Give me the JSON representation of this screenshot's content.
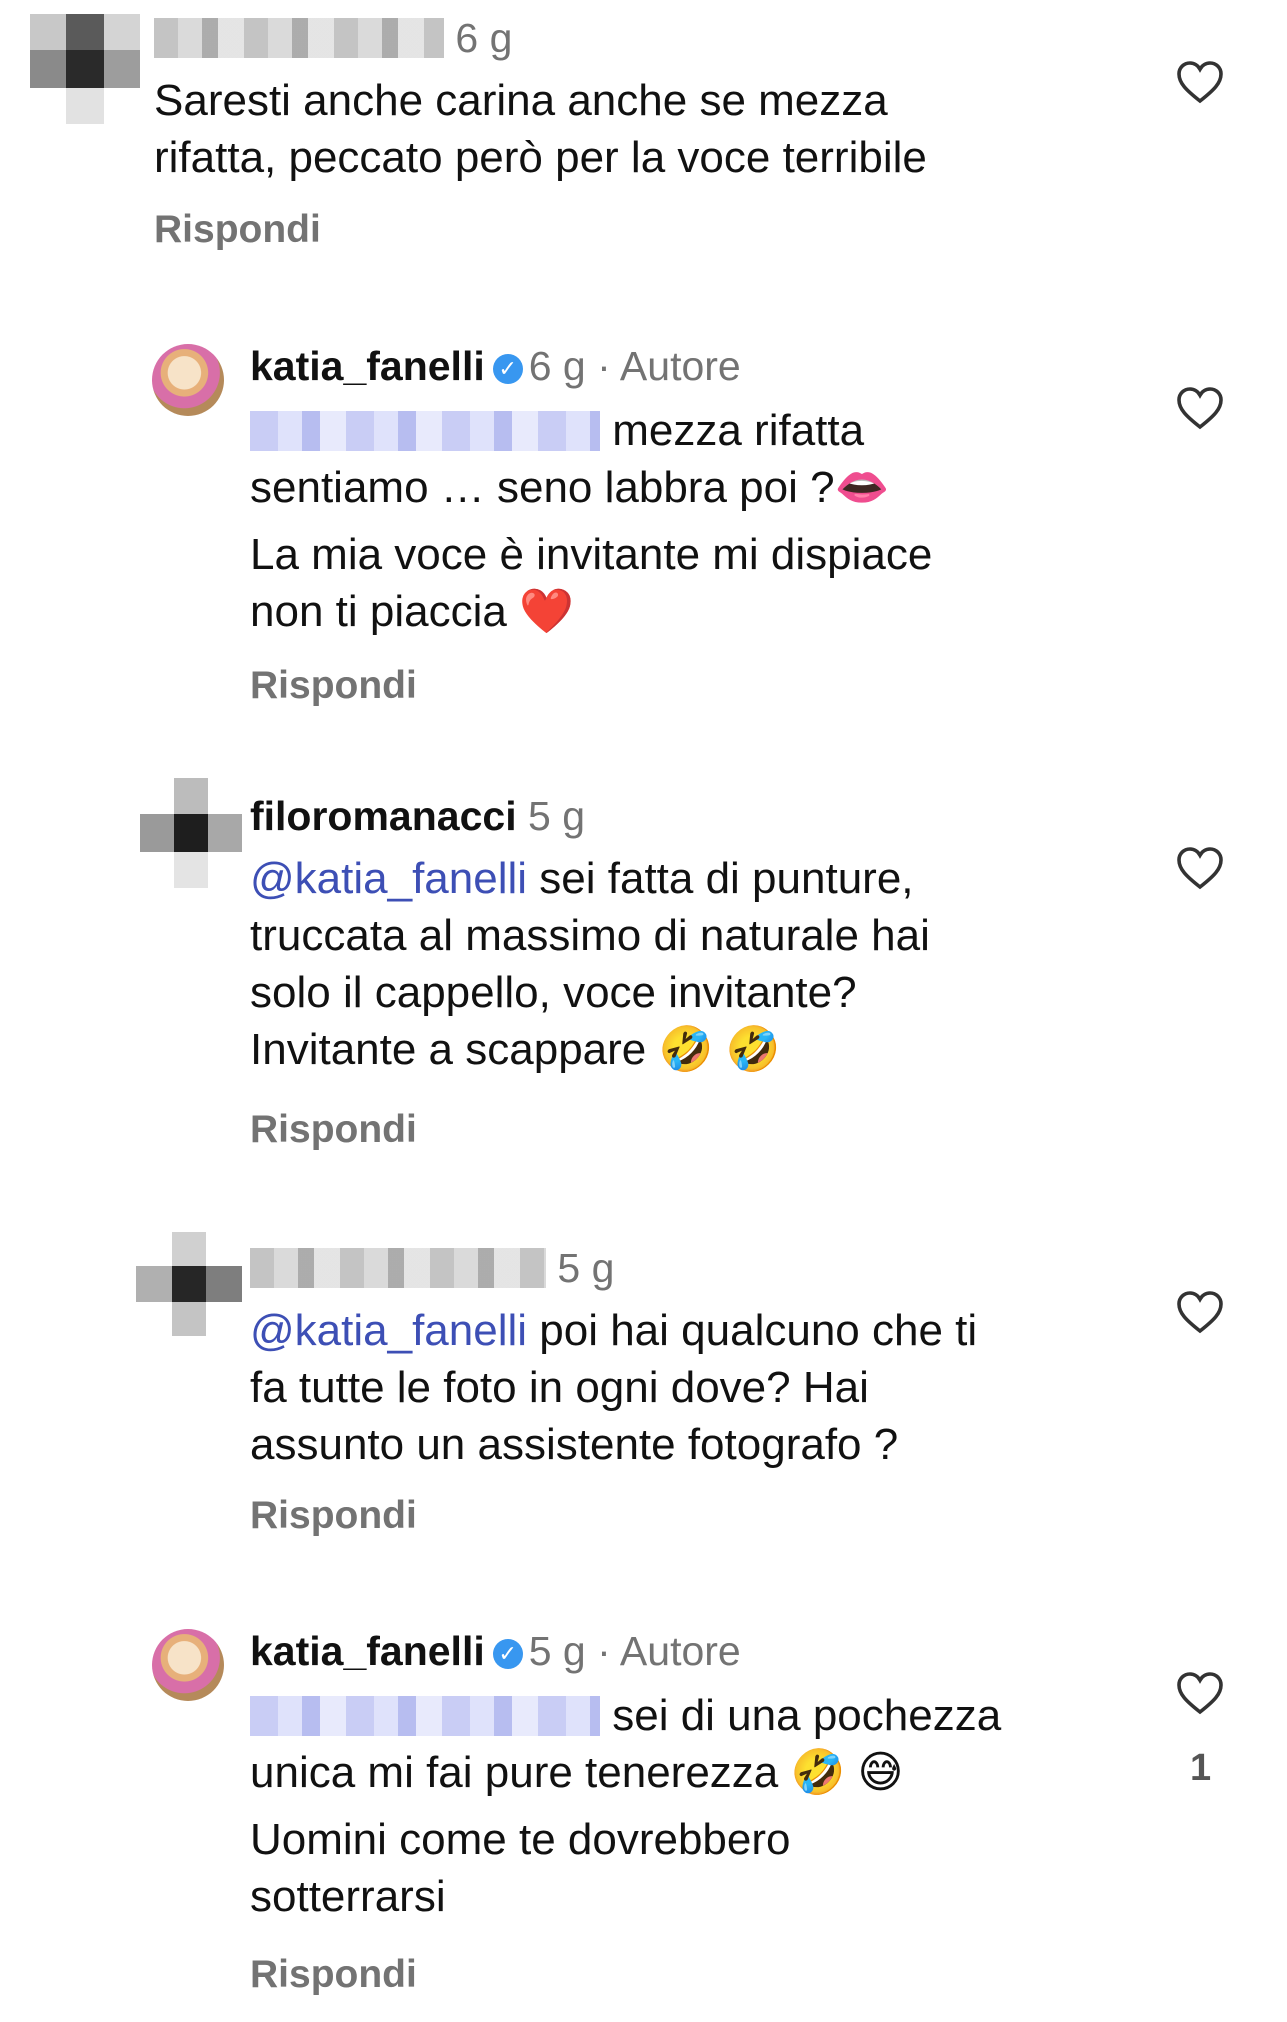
{
  "comments": [
    {
      "username": "",
      "time": "6 g",
      "text_lines": [
        "Saresti anche carina anche se mezza",
        "rifatta, peccato però per la voce terribile"
      ],
      "reply_label": "Rispondi"
    },
    {
      "username": "katia_fanelli",
      "time": "6 g",
      "author_label": "· Autore",
      "line1_after_redact": "mezza rifatta",
      "lines": [
        "sentiamo … seno labbra poi ?👄",
        "La mia voce è invitante mi dispiace",
        "non ti piaccia ❤️"
      ],
      "reply_label": "Rispondi"
    },
    {
      "username": "filoromanacci",
      "time": "5 g",
      "mention": "@katia_fanelli",
      "line1_after_mention": " sei fatta di punture,",
      "lines": [
        "truccata al massimo di naturale hai",
        "solo il cappello, voce invitante?",
        "Invitante a scappare 🤣 🤣"
      ],
      "reply_label": "Rispondi"
    },
    {
      "username": "",
      "time": "5 g",
      "mention": "@katia_fanelli",
      "line1_after_mention": " poi hai qualcuno che ti",
      "lines": [
        "fa tutte le foto in ogni dove? Hai",
        "assunto un assistente fotografo ?"
      ],
      "reply_label": "Rispondi"
    },
    {
      "username": "katia_fanelli",
      "time": "5 g",
      "author_label": "· Autore",
      "line1_after_redact": "sei di una pochezza",
      "lines": [
        "unica mi fai pure tenerezza 🤣 😅",
        "Uomini come te dovrebbero",
        "sotterrarsi"
      ],
      "reply_label": "Rispondi",
      "like_count": "1"
    }
  ],
  "icons": {
    "like": "heart-outline-icon",
    "verified": "verified-badge-icon"
  },
  "colors": {
    "mention": "#3d4fb5",
    "secondary_text": "#737373",
    "verified": "#3897f0"
  }
}
